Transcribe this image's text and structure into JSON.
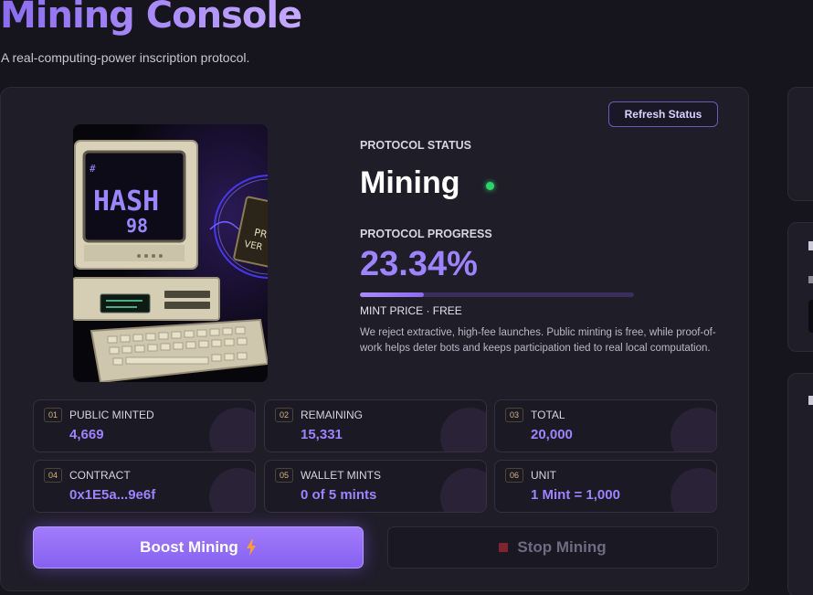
{
  "header": {
    "title": "Mining Console",
    "subtitle": "A real-computing-power inscription protocol."
  },
  "console": {
    "refresh_label": "Refresh Status",
    "hero": {
      "icon": "retro-computer-illustration",
      "screen_text_line1": "HASH",
      "screen_text_line2": "98",
      "screen_tag": "#",
      "card_text_line1": "PR",
      "card_text_line2": "VER"
    },
    "status": {
      "label": "PROTOCOL STATUS",
      "value": "Mining",
      "indicator_color": "#2fd36a"
    },
    "progress": {
      "label": "PROTOCOL PROGRESS",
      "value": "23.34%",
      "fraction": 0.2334
    },
    "mint_price": "MINT PRICE · FREE",
    "description": "We reject extractive, high-fee launches. Public minting is free, while proof-of-work helps deter bots and keeps participation tied to real local computation.",
    "stats": [
      {
        "index": "01",
        "label": "PUBLIC MINTED",
        "value": "4,669"
      },
      {
        "index": "02",
        "label": "REMAINING",
        "value": "15,331"
      },
      {
        "index": "03",
        "label": "TOTAL",
        "value": "20,000"
      },
      {
        "index": "04",
        "label": "CONTRACT",
        "value": "0x1E5a...9e6f"
      },
      {
        "index": "05",
        "label": "WALLET MINTS",
        "value": "0 of 5 mints"
      },
      {
        "index": "06",
        "label": "UNIT",
        "value": "1 Mint = 1,000"
      }
    ],
    "boost_label": "Boost Mining",
    "boost_icon": "lightning-bolt-icon",
    "stop_label": "Stop Mining",
    "stop_icon": "stop-square-icon"
  },
  "colors": {
    "accent": "#9d83ff",
    "background": "#16141d",
    "card": "#1f1d28",
    "status_green": "#2fd36a"
  }
}
